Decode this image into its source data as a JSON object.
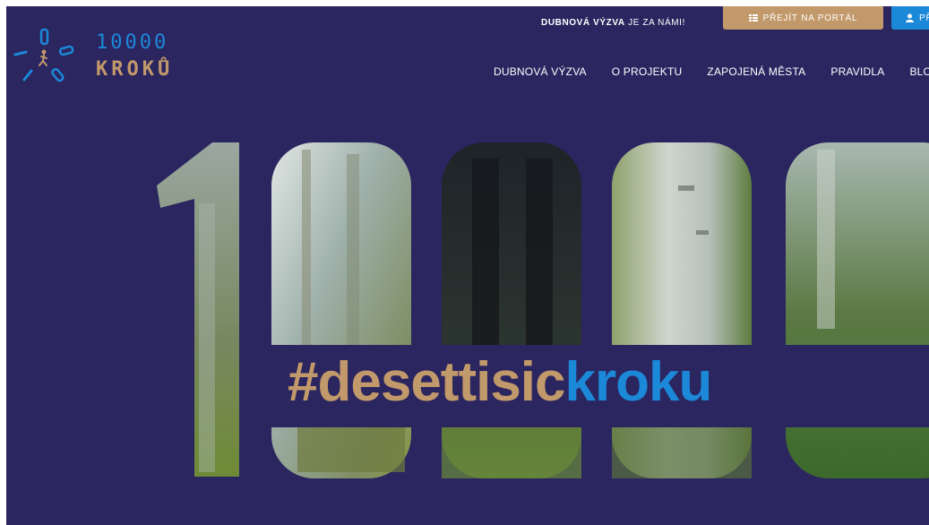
{
  "topbar": {
    "announce_bold": "DUBNOVÁ VÝZVA",
    "announce_rest": " JE ZA NÁMI!",
    "portal_button": "PŘEJÍT NA PORTÁL",
    "login_button": "PŘ"
  },
  "logo": {
    "number": "10000",
    "word": "KROKŮ"
  },
  "nav": {
    "items": [
      "DUBNOVÁ VÝZVA",
      "O PROJEKTU",
      "ZAPOJENÁ MĚSTA",
      "PRAVIDLA",
      "BLOG"
    ]
  },
  "hero": {
    "hashtag_part1": "#desetti",
    "hashtag_part2": "sic",
    "hashtag_part3": "kroku"
  },
  "colors": {
    "background": "#2b2560",
    "gold": "#c2996a",
    "blue": "#1c89d8"
  },
  "icons": {
    "portal": "grid-list-icon",
    "login": "user-icon"
  }
}
